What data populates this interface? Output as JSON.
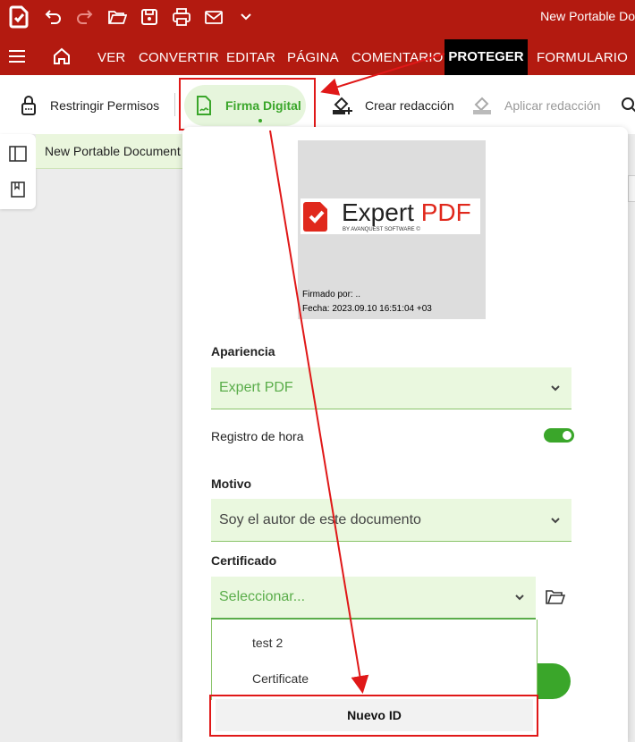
{
  "window": {
    "doc_title": "New Portable Do"
  },
  "menu": {
    "items": [
      "VER",
      "CONVERTIR",
      "EDITAR",
      "PÁGINA",
      "COMENTARIO"
    ],
    "active": "PROTEGER",
    "after": "FORMULARIO"
  },
  "toolbar": {
    "restrict": "Restringir Permisos",
    "signature": "Firma Digital",
    "create_redaction": "Crear redacción",
    "apply_redaction": "Aplicar redacción"
  },
  "doc_tab": "New Portable Document",
  "preview": {
    "logo_main": "Expert",
    "logo_accent": "PDF",
    "logo_sub": "BY AVANQUEST SOFTWARE ©",
    "signed_by": "Firmado por: ..",
    "date": "Fecha: 2023.09.10 16:51:04 +03"
  },
  "form": {
    "appearance_label": "Apariencia",
    "appearance_value": "Expert PDF",
    "timestamp_label": "Registro de hora",
    "timestamp_on": true,
    "reason_label": "Motivo",
    "reason_value": "Soy el autor de este documento",
    "certificate_label": "Certificado",
    "certificate_placeholder": "Seleccionar...",
    "certificate_options": [
      "test 2",
      "Certificate"
    ],
    "new_id": "Nuevo ID"
  },
  "colors": {
    "brand_red": "#b31a10",
    "accent_green": "#3aa62a",
    "annotation_red": "#e01818"
  }
}
